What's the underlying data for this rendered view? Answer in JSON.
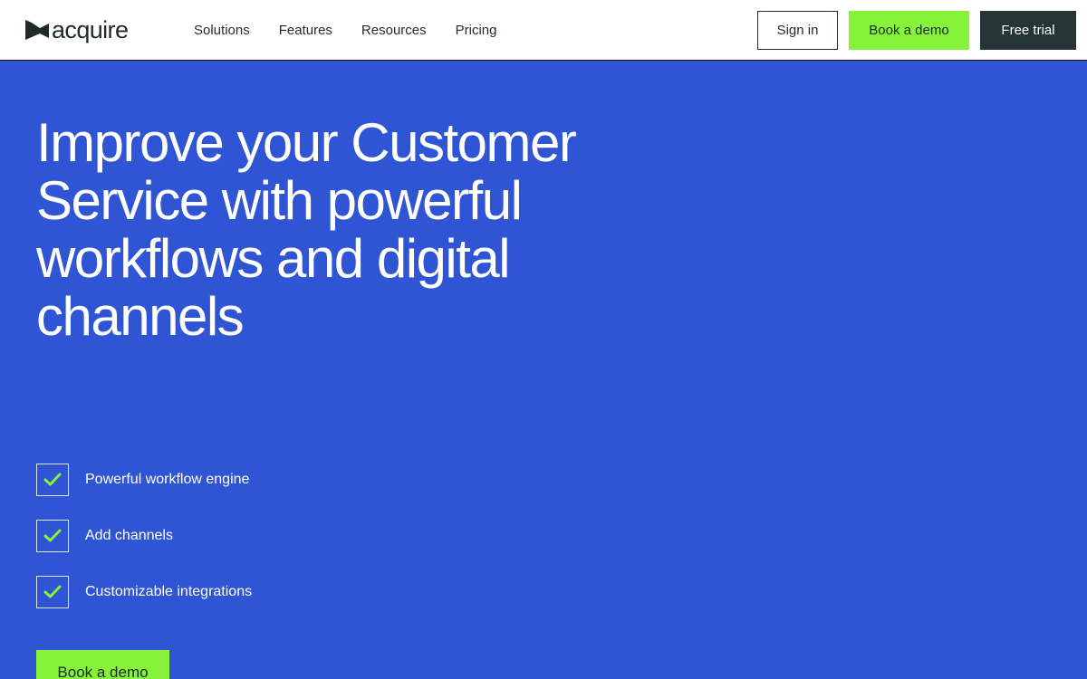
{
  "brand": {
    "name": "acquire",
    "logo_icon": "acquire-flag-logo",
    "colors": {
      "primary_blue": "#2f55d4",
      "accent_green": "#86f23a",
      "dark": "#253535",
      "white": "#ffffff"
    }
  },
  "nav": {
    "items": [
      {
        "label": "Solutions"
      },
      {
        "label": "Features"
      },
      {
        "label": "Resources"
      },
      {
        "label": "Pricing"
      }
    ]
  },
  "header_actions": {
    "sign_in": "Sign in",
    "book_demo": "Book a demo",
    "free_trial": "Free trial"
  },
  "hero": {
    "title": "Improve your Customer Service with powerful workflows and digital channels",
    "features": [
      {
        "label": "Powerful workflow engine",
        "icon": "checkmark-icon"
      },
      {
        "label": "Add channels",
        "icon": "checkmark-icon"
      },
      {
        "label": "Customizable integrations",
        "icon": "checkmark-icon"
      }
    ],
    "cta": "Book a demo"
  }
}
